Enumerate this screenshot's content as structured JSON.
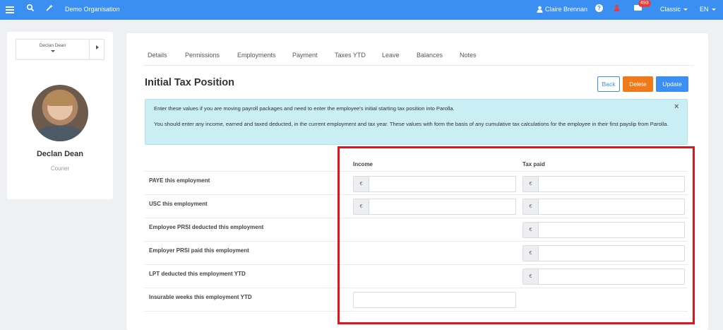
{
  "topbar": {
    "org": "Demo Organisation",
    "user": "Claire Brennan",
    "help": "?",
    "mail_badge": "493",
    "view": "Classic",
    "lang": "EN"
  },
  "employee": {
    "select_label": "Declan Dean",
    "name": "Declan Dean",
    "role": "Courier"
  },
  "tabs": [
    "Details",
    "Permissions",
    "Employments",
    "Payment",
    "Taxes YTD",
    "Leave",
    "Balances",
    "Notes"
  ],
  "page": {
    "title": "Initial Tax Position",
    "back": "Back",
    "delete": "Delete",
    "update": "Update"
  },
  "info": {
    "line1": "Enter these values if you are moving payroll packages and need to enter the employee's initial starting tax position into Parolla.",
    "line2": "You should enter any income, earned and taxed deducted, in the current employment and tax year. These values with form the basis of any cumulative tax calculations for the employee in their first payslip from Parolla.",
    "close": "×"
  },
  "table": {
    "col_income": "Income",
    "col_tax": "Tax paid",
    "currency": "€",
    "rows": [
      {
        "label": "PAYE this employment"
      },
      {
        "label": "USC this employment"
      },
      {
        "label": "Employee PRSI deducted this employment"
      },
      {
        "label": "Employer PRSI paid this employment"
      },
      {
        "label": "LPT deducted this employment YTD"
      },
      {
        "label": "Insurable weeks this employment YTD"
      }
    ]
  },
  "colors": {
    "primary": "#3b8ff2",
    "delete": "#f07a1a",
    "info_bg": "#c9eef3",
    "highlight": "#e0141e"
  }
}
